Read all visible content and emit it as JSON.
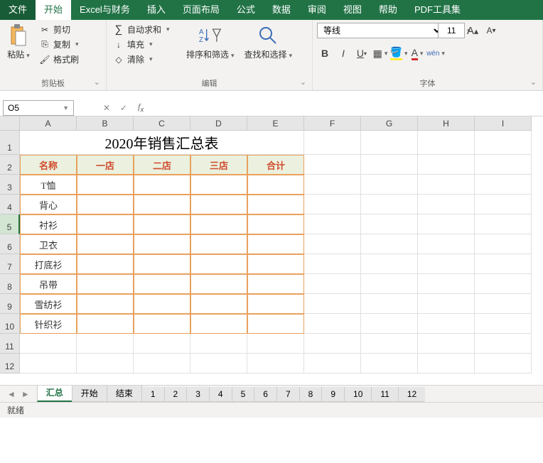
{
  "tabs": {
    "file": "文件",
    "home": "开始",
    "excel_fin": "Excel与财务",
    "insert": "插入",
    "pagelayout": "页面布局",
    "formulas": "公式",
    "data": "数据",
    "review": "审阅",
    "view": "视图",
    "help": "帮助",
    "pdf": "PDF工具集"
  },
  "ribbon": {
    "clipboard": {
      "paste": "粘贴",
      "cut": "剪切",
      "copy": "复制",
      "format_painter": "格式刷",
      "label": "剪贴板"
    },
    "edit": {
      "autosum": "自动求和",
      "fill": "填充",
      "clear": "清除",
      "label": "编辑"
    },
    "sortfilter": "排序和筛选",
    "findselect": "查找和选择",
    "font": {
      "name": "等线",
      "size": "11",
      "wen": "wén",
      "label": "字体"
    }
  },
  "namebox": "O5",
  "formula": "",
  "grid": {
    "columns": [
      "A",
      "B",
      "C",
      "D",
      "E",
      "F",
      "G",
      "H",
      "I"
    ],
    "title": "2020年销售汇总表",
    "headers": [
      "名称",
      "一店",
      "二店",
      "三店",
      "合计"
    ],
    "rows": [
      "T恤",
      "背心",
      "衬衫",
      "卫衣",
      "打底衫",
      "吊带",
      "雪纺衫",
      "针织衫"
    ],
    "row_nums": [
      "1",
      "2",
      "3",
      "4",
      "5",
      "6",
      "7",
      "8",
      "9",
      "10",
      "11",
      "12"
    ]
  },
  "sheets": {
    "nav": [
      "◄",
      "►"
    ],
    "tabs": [
      "汇总",
      "开始",
      "结束",
      "1",
      "2",
      "3",
      "4",
      "5",
      "6",
      "7",
      "8",
      "9",
      "10",
      "11",
      "12"
    ],
    "active": 0
  },
  "status": "就绪"
}
